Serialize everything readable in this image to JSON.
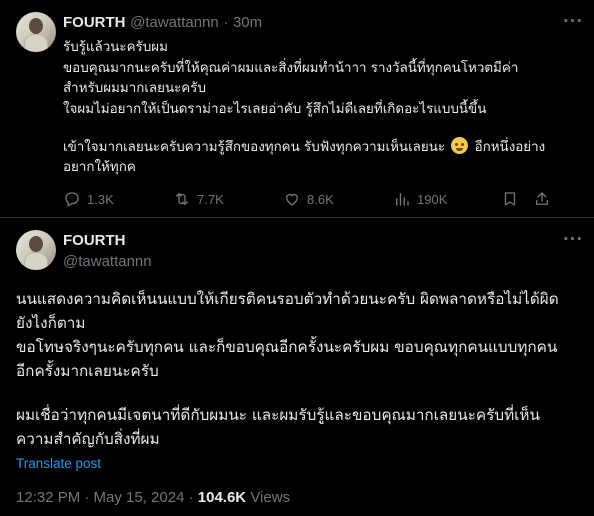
{
  "post1": {
    "name": "FOURTH",
    "handle": "@tawattannn",
    "separator": "·",
    "time": "30m",
    "lines": [
      "รับรู้แล้วนะครับผม",
      "ขอบคุณมากนะครับที่ให้คุณค่าผมและสิ่งที่ผมทำน้าาา รางวัลนี้ที่ทุกคนโหวตมีค่า",
      "สำหรับผมมากเลยนะครับ",
      "ใจผมไม่อยากให้เป็นดราม่าอะไรเลยอ่าคับ รู้สึกไม่ดีเลยที่เกิดอะไรแบบนี้ขึ้น",
      "เข้าใจมากเลยนะครับความรู้สึกของทุกคน รับฟังทุกความเห็นเลยนะ",
      "อีกหนึ่งอย่าง",
      "อยากให้ทุกค"
    ],
    "emoji_icon": "pleading-face-emoji",
    "stats": {
      "replies": "1.3K",
      "reposts": "7.7K",
      "likes": "8.6K",
      "views": "190K"
    }
  },
  "post2": {
    "name": "FOURTH",
    "handle": "@tawattannn",
    "lines": [
      "นนแสดงความคิดเห็นนแบบให้เกียรติคนรอบตัวทำด้วยนะครับ ผิดพลาดหรือไม่ได้ผิด",
      "ยังไงก็ตาม",
      "ขอโทษจริงๆนะครับทุกคน และก็ขอบคุณอีกครั้งนะครับผม ขอบคุณทุกคนแบบทุกคน",
      "อีกครั้งมากเลยนะครับ",
      "ผมเชื่อว่าทุกคนมีเจตนาที่ดีกับผมนะ และผมรับรู้และขอบคุณมากเลยนะครับที่เห็น",
      "ความสำคัญกับสิ่งที่ผม"
    ],
    "translate": "Translate post",
    "timestamp": "12:32 PM · May 15, 2024 ·",
    "views_count": "104.6K",
    "views_label": "Views"
  },
  "colors": {
    "background": "#000000",
    "text": "#e7e9ea",
    "muted": "#71767b",
    "accent": "#1d9bf0",
    "divider": "#2f3336"
  }
}
